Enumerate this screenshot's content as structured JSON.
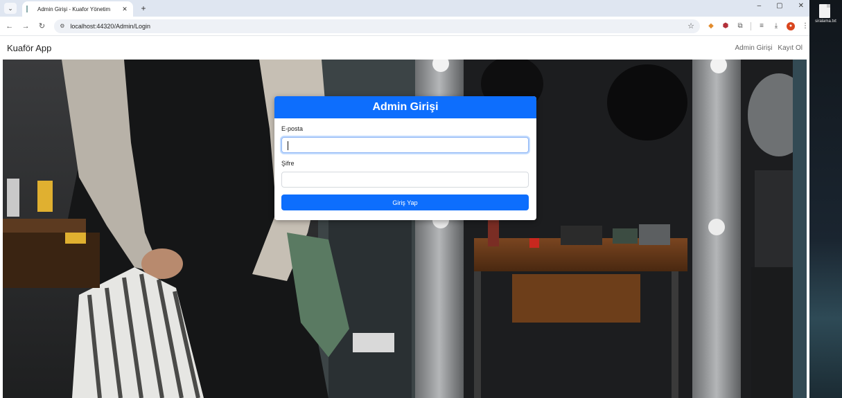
{
  "browser": {
    "tab_title": "Admin Girişi - Kuafor Yönetim",
    "tab_close": "✕",
    "new_tab": "+",
    "url": "localhost:44320/Admin/Login",
    "window_controls": [
      "–",
      "▢",
      "✕"
    ]
  },
  "app": {
    "brand": "Kuaför App",
    "nav_links": [
      "Admin Girişi",
      "Kayıt Ol"
    ]
  },
  "login": {
    "title": "Admin Girişi",
    "email_label": "E-posta",
    "email_value": "",
    "password_label": "Şifre",
    "password_value": "",
    "submit_label": "Giriş Yap"
  },
  "desktop": {
    "file_label": "siralama.txt"
  },
  "colors": {
    "primary": "#0d6efd"
  }
}
